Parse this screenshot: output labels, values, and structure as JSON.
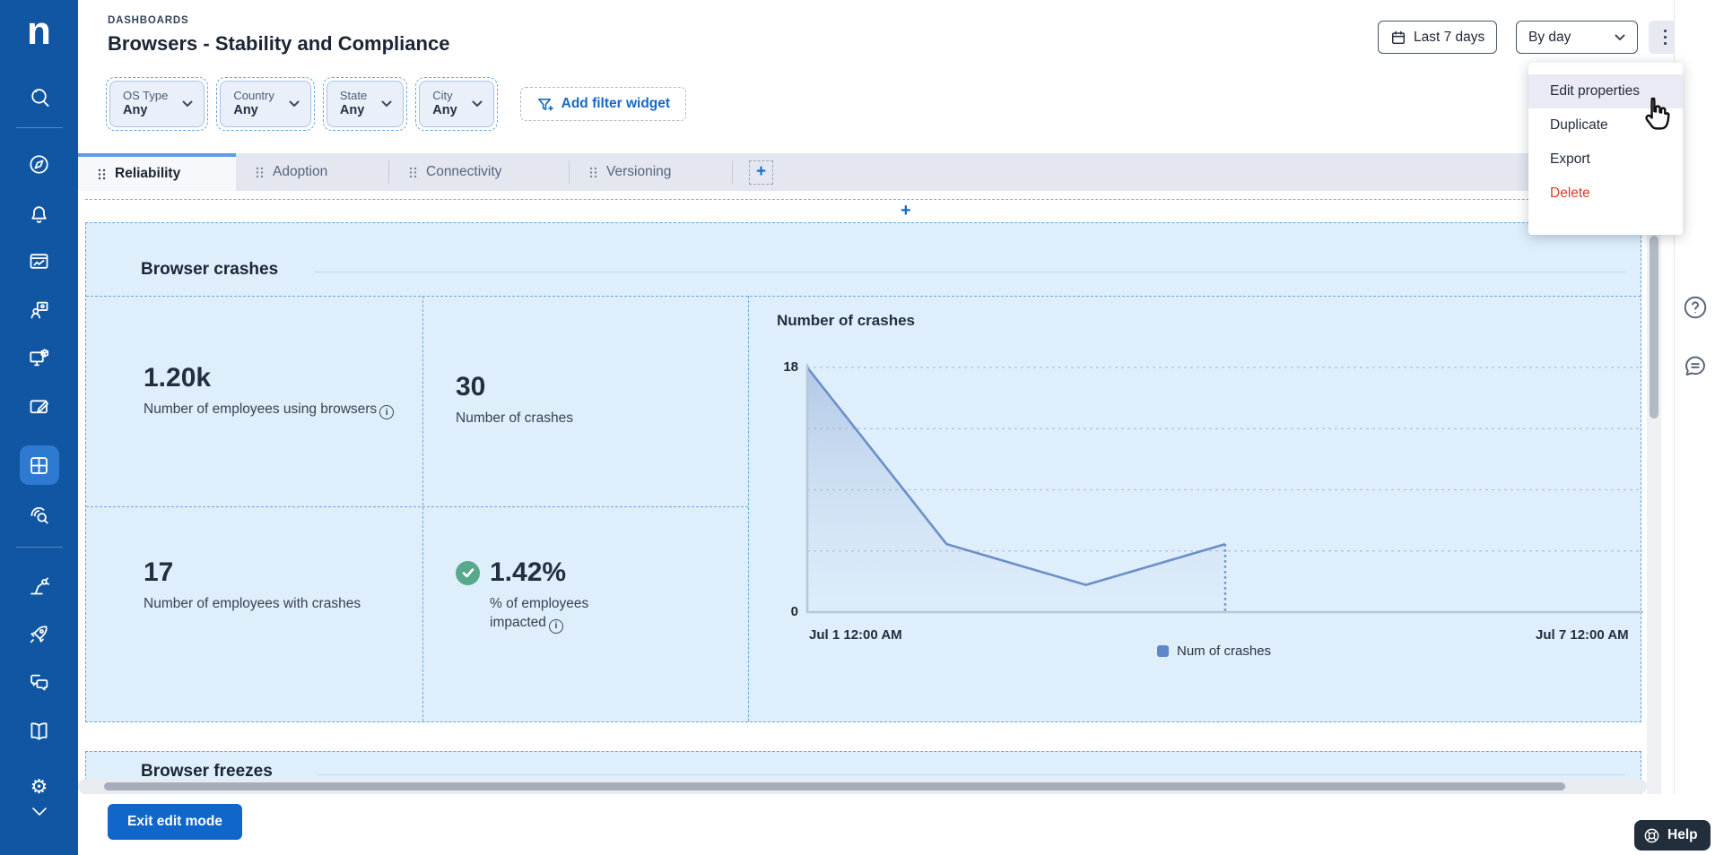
{
  "brand": {
    "logo_letter": "n"
  },
  "sidebar": {
    "icons": [
      "ai-search",
      "explore-compass",
      "alerts-bell",
      "device-view-monitor",
      "workforce-people",
      "remote-action-device-cube",
      "content-editor-card-pen",
      "dashboards-grid",
      "investigate-fingerprint-search",
      "automation-robot-arm",
      "adopt-rocket",
      "engage-chat-bubbles",
      "library-book",
      "settings-gear",
      "collapse-chevron-down"
    ],
    "active": "dashboards-grid"
  },
  "header": {
    "breadcrumb": "DASHBOARDS",
    "title": "Browsers - Stability and Compliance"
  },
  "toolbar": {
    "date_range": "Last 7 days",
    "granularity": "By day"
  },
  "menu": {
    "items": [
      {
        "label": "Edit properties",
        "highlighted": true
      },
      {
        "label": "Duplicate"
      },
      {
        "label": "Export"
      },
      {
        "label": "Delete",
        "danger": true
      }
    ]
  },
  "filters": {
    "widgets": [
      {
        "label": "OS Type",
        "value": "Any"
      },
      {
        "label": "Country",
        "value": "Any"
      },
      {
        "label": "State",
        "value": "Any"
      },
      {
        "label": "City",
        "value": "Any"
      }
    ],
    "add_label": "Add filter widget"
  },
  "tabs": [
    {
      "label": "Reliability",
      "active": true
    },
    {
      "label": "Adoption",
      "active": false
    },
    {
      "label": "Connectivity",
      "active": false
    },
    {
      "label": "Versioning",
      "active": false
    }
  ],
  "sections": {
    "crashes": {
      "title": "Browser crashes",
      "kpis": [
        {
          "value": "1.20k",
          "label": "Number of employees using browsers",
          "info": true
        },
        {
          "value": "30",
          "label": "Number of crashes"
        },
        {
          "value": "17",
          "label": "Number of employees with crashes"
        },
        {
          "value": "1.42%",
          "label": "% of employees impacted",
          "info": true,
          "status": "good"
        }
      ]
    },
    "freezes": {
      "title": "Browser freezes"
    }
  },
  "chart_data": {
    "type": "area",
    "title": "Number of crashes",
    "x": [
      "Jul 1",
      "Jul 2",
      "Jul 3",
      "Jul 4"
    ],
    "values": [
      18,
      5,
      2,
      5
    ],
    "x_axis_range": [
      "Jul 1 12:00 AM",
      "Jul 7 12:00 AM"
    ],
    "x_axis_span_days": 6,
    "ylim": [
      0,
      18
    ],
    "y_tick_labels": [
      "18",
      "0"
    ],
    "gridline_intervals": 4,
    "grid": "dashed horizontal",
    "legend": [
      {
        "label": "Num of crashes",
        "color": "#5d87c8"
      }
    ],
    "legend_position": "bottom",
    "annotation": "dashed vertical guide at last data point"
  },
  "footer": {
    "exit_button": "Exit edit mode",
    "help_label": "Help"
  },
  "colors": {
    "accent_blue": "#1569c8",
    "sidebar_blue": "#1156a3",
    "sidebar_active": "#2f7ad1",
    "canvas_blue": "#dfeefb",
    "tab_bar": "#e4e7f0",
    "chart_line": "#6b8fc9",
    "success_green": "#57a98c",
    "danger_red": "#d6402e"
  }
}
